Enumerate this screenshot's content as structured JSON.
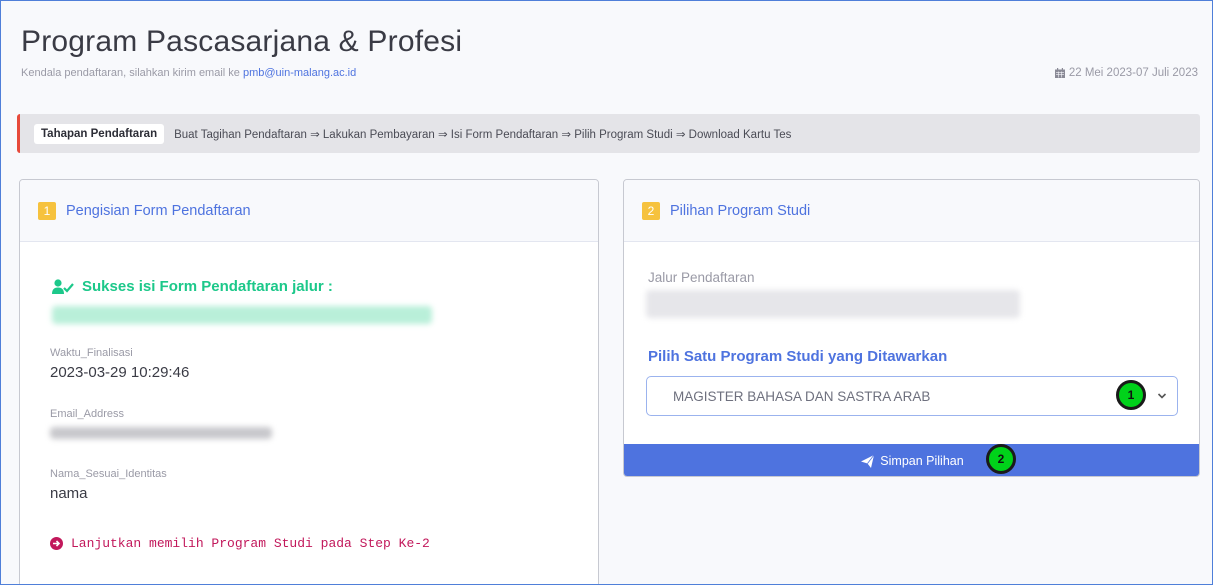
{
  "header": {
    "title": "Program Pascasarjana & Profesi",
    "help_text": "Kendala pendaftaran, silahkan kirim email ke",
    "help_email": "pmb@uin-malang.ac.id",
    "date_range": "22 Mei 2023-07 Juli 2023",
    "calendar_icon": "calendar-icon"
  },
  "steps": {
    "badge": "Tahapan Pendaftaran",
    "text": "Buat Tagihan Pendaftaran ⇒ Lakukan Pembayaran ⇒ Isi Form Pendaftaran ⇒ Pilih Program Studi ⇒ Download Kartu Tes"
  },
  "card1": {
    "number": "1",
    "title": "Pengisian Form Pendaftaran",
    "success_text": "Sukses isi Form Pendaftaran jalur :",
    "fields": [
      {
        "label": "Waktu_Finalisasi",
        "value": "2023-03-29 10:29:46"
      },
      {
        "label": "Email_Address",
        "value": ""
      },
      {
        "label": "Nama_Sesuai_Identitas",
        "value": "nama"
      }
    ],
    "next_step": "Lanjutkan memilih Program Studi pada Step Ke-2"
  },
  "card2": {
    "number": "2",
    "title": "Pilihan Program Studi",
    "jalur_label": "Jalur Pendaftaran",
    "select_label": "Pilih Satu Program Studi yang Ditawarkan",
    "selected_option": "MAGISTER BAHASA DAN SASTRA ARAB",
    "save_label": "Simpan Pilihan"
  },
  "markers": [
    "1",
    "2"
  ],
  "colors": {
    "primary": "#4e73df",
    "success": "#1cc88a",
    "warning": "#f6c23e",
    "danger": "#e74a3b",
    "marker": "#00d21a"
  }
}
